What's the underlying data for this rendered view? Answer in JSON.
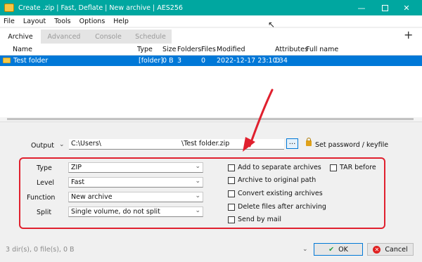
{
  "window": {
    "title": "Create .zip | Fast, Deflate | New archive | AES256",
    "icon": "archive-app-icon"
  },
  "menu": [
    "File",
    "Layout",
    "Tools",
    "Options",
    "Help"
  ],
  "tabs": [
    {
      "label": "Archive",
      "active": true
    },
    {
      "label": "Advanced",
      "active": false
    },
    {
      "label": "Console",
      "active": false
    },
    {
      "label": "Schedule",
      "active": false
    }
  ],
  "list": {
    "columns": [
      "Name",
      "Type",
      "Size",
      "Folders",
      "Files",
      "Modified",
      "Attributes",
      "Full name"
    ],
    "rows": [
      {
        "name": "Test folder",
        "type": "[folder]",
        "size": "0 B",
        "folders": "3",
        "files": "0",
        "modified": "2022-12-17 23:10:34",
        "attributes": "D",
        "full_name": ""
      }
    ]
  },
  "output": {
    "label": "Output",
    "path_left": "C:\\Users\\",
    "path_right": "\\Test folder.zip",
    "browse_label": "...",
    "set_password": "Set password / keyfile"
  },
  "settings": {
    "type_label": "Type",
    "type_value": "ZIP",
    "level_label": "Level",
    "level_value": "Fast",
    "function_label": "Function",
    "function_value": "New archive",
    "split_label": "Split",
    "split_value": "Single volume, do not split"
  },
  "options": [
    {
      "label": "Add to separate archives",
      "checked": false
    },
    {
      "label": "Archive to original path",
      "checked": false
    },
    {
      "label": "Convert existing archives",
      "checked": false
    },
    {
      "label": "Delete files after archiving",
      "checked": false
    },
    {
      "label": "Send by mail",
      "checked": false
    },
    {
      "label": "TAR before",
      "checked": false
    }
  ],
  "status": "3 dir(s), 0 file(s), 0 B",
  "buttons": {
    "ok": "OK",
    "cancel": "Cancel"
  },
  "colors": {
    "titlebar": "#00a7a0",
    "selection": "#0078d7",
    "annotation": "#e0202e"
  }
}
